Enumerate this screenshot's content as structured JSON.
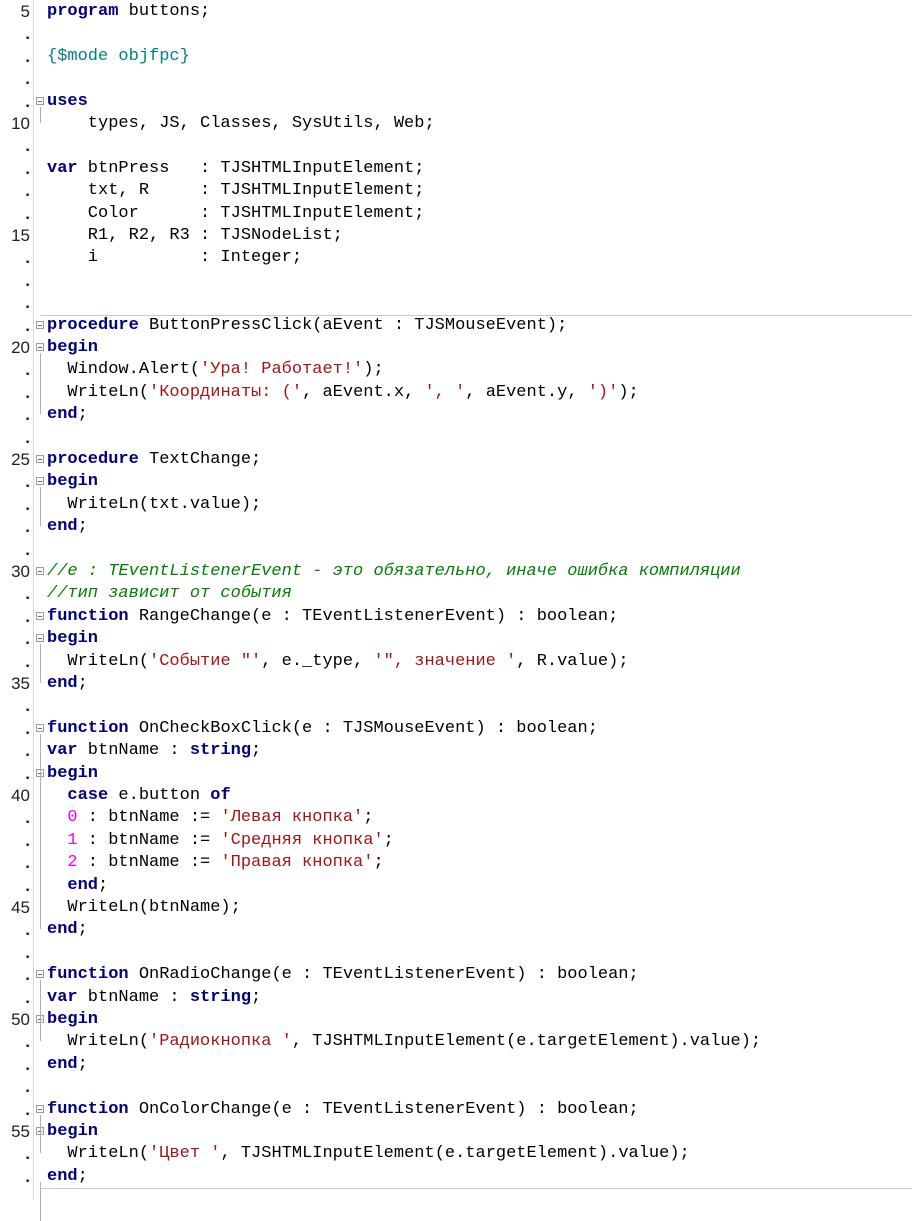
{
  "editor": {
    "lines": [
      {
        "n": "5",
        "fold": false,
        "tokens": [
          {
            "t": "kw",
            "v": "program"
          },
          {
            "t": "id",
            "v": " buttons;"
          }
        ]
      },
      {
        "n": ".",
        "fold": false,
        "tokens": []
      },
      {
        "n": ".",
        "fold": false,
        "tokens": [
          {
            "t": "dir",
            "v": "{$mode objfpc}"
          }
        ]
      },
      {
        "n": ".",
        "fold": false,
        "tokens": []
      },
      {
        "n": ".",
        "fold": true,
        "tokens": [
          {
            "t": "kw",
            "v": "uses"
          }
        ]
      },
      {
        "n": "10",
        "fold": false,
        "tokens": [
          {
            "t": "id",
            "v": "    types, JS, Classes, SysUtils, Web;"
          }
        ]
      },
      {
        "n": ".",
        "fold": false,
        "tokens": []
      },
      {
        "n": ".",
        "fold": false,
        "tokens": [
          {
            "t": "kw",
            "v": "var"
          },
          {
            "t": "id",
            "v": " btnPress   : TJSHTMLInputElement;"
          }
        ]
      },
      {
        "n": ".",
        "fold": false,
        "tokens": [
          {
            "t": "id",
            "v": "    txt, R     : TJSHTMLInputElement;"
          }
        ]
      },
      {
        "n": ".",
        "fold": false,
        "tokens": [
          {
            "t": "id",
            "v": "    Color      : TJSHTMLInputElement;"
          }
        ]
      },
      {
        "n": "15",
        "fold": false,
        "tokens": [
          {
            "t": "id",
            "v": "    R1, R2, R3 : TJSNodeList;"
          }
        ]
      },
      {
        "n": ".",
        "fold": false,
        "tokens": [
          {
            "t": "id",
            "v": "    i          : Integer;"
          }
        ]
      },
      {
        "n": ".",
        "fold": false,
        "tokens": []
      },
      {
        "n": ".",
        "fold": false,
        "tokens": []
      },
      {
        "n": ".",
        "fold": true,
        "tokens": [
          {
            "t": "kw",
            "v": "procedure"
          },
          {
            "t": "id",
            "v": " ButtonPressClick(aEvent : TJSMouseEvent);"
          }
        ]
      },
      {
        "n": "20",
        "fold": true,
        "tokens": [
          {
            "t": "kw",
            "v": "begin"
          }
        ]
      },
      {
        "n": ".",
        "fold": false,
        "tokens": [
          {
            "t": "id",
            "v": "  Window.Alert("
          },
          {
            "t": "str",
            "v": "'Ура! Работает!'"
          },
          {
            "t": "id",
            "v": ");"
          }
        ]
      },
      {
        "n": ".",
        "fold": false,
        "tokens": [
          {
            "t": "id",
            "v": "  WriteLn("
          },
          {
            "t": "str",
            "v": "'Координаты: ('"
          },
          {
            "t": "id",
            "v": ", aEvent.x, "
          },
          {
            "t": "str",
            "v": "', '"
          },
          {
            "t": "id",
            "v": ", aEvent.y, "
          },
          {
            "t": "str",
            "v": "')'"
          },
          {
            "t": "id",
            "v": ");"
          }
        ]
      },
      {
        "n": ".",
        "fold": false,
        "tokens": [
          {
            "t": "kw",
            "v": "end"
          },
          {
            "t": "id",
            "v": ";"
          }
        ]
      },
      {
        "n": ".",
        "fold": false,
        "tokens": []
      },
      {
        "n": "25",
        "fold": true,
        "tokens": [
          {
            "t": "kw",
            "v": "procedure"
          },
          {
            "t": "id",
            "v": " TextChange;"
          }
        ]
      },
      {
        "n": ".",
        "fold": true,
        "tokens": [
          {
            "t": "kw",
            "v": "begin"
          }
        ]
      },
      {
        "n": ".",
        "fold": false,
        "tokens": [
          {
            "t": "id",
            "v": "  WriteLn(txt.value);"
          }
        ]
      },
      {
        "n": ".",
        "fold": false,
        "tokens": [
          {
            "t": "kw",
            "v": "end"
          },
          {
            "t": "id",
            "v": ";"
          }
        ]
      },
      {
        "n": ".",
        "fold": false,
        "tokens": []
      },
      {
        "n": "30",
        "fold": true,
        "tokens": [
          {
            "t": "cmt",
            "v": "//e : TEventListenerEvent - это обязательно, иначе ошибка компиляции"
          }
        ]
      },
      {
        "n": ".",
        "fold": false,
        "tokens": [
          {
            "t": "cmt",
            "v": "//тип зависит от события"
          }
        ]
      },
      {
        "n": ".",
        "fold": true,
        "tokens": [
          {
            "t": "kw",
            "v": "function"
          },
          {
            "t": "id",
            "v": " RangeChange(e : TEventListenerEvent) : boolean;"
          }
        ]
      },
      {
        "n": ".",
        "fold": true,
        "tokens": [
          {
            "t": "kw",
            "v": "begin"
          }
        ]
      },
      {
        "n": ".",
        "fold": false,
        "tokens": [
          {
            "t": "id",
            "v": "  WriteLn("
          },
          {
            "t": "str",
            "v": "'Событие \"'"
          },
          {
            "t": "id",
            "v": ", e._type, "
          },
          {
            "t": "str",
            "v": "'\", значение '"
          },
          {
            "t": "id",
            "v": ", R.value);"
          }
        ]
      },
      {
        "n": "35",
        "fold": false,
        "tokens": [
          {
            "t": "kw",
            "v": "end"
          },
          {
            "t": "id",
            "v": ";"
          }
        ]
      },
      {
        "n": ".",
        "fold": false,
        "tokens": []
      },
      {
        "n": ".",
        "fold": true,
        "tokens": [
          {
            "t": "kw",
            "v": "function"
          },
          {
            "t": "id",
            "v": " OnCheckBoxClick(e : TJSMouseEvent) : boolean;"
          }
        ]
      },
      {
        "n": ".",
        "fold": false,
        "tokens": [
          {
            "t": "kw",
            "v": "var"
          },
          {
            "t": "id",
            "v": " btnName : "
          },
          {
            "t": "kw",
            "v": "string"
          },
          {
            "t": "id",
            "v": ";"
          }
        ]
      },
      {
        "n": ".",
        "fold": true,
        "tokens": [
          {
            "t": "kw",
            "v": "begin"
          }
        ]
      },
      {
        "n": "40",
        "fold": false,
        "tokens": [
          {
            "t": "id",
            "v": "  "
          },
          {
            "t": "kw",
            "v": "case"
          },
          {
            "t": "id",
            "v": " e.button "
          },
          {
            "t": "kw",
            "v": "of"
          }
        ]
      },
      {
        "n": ".",
        "fold": false,
        "tokens": [
          {
            "t": "id",
            "v": "  "
          },
          {
            "t": "num",
            "v": "0"
          },
          {
            "t": "id",
            "v": " : btnName := "
          },
          {
            "t": "str",
            "v": "'Левая кнопка'"
          },
          {
            "t": "id",
            "v": ";"
          }
        ]
      },
      {
        "n": ".",
        "fold": false,
        "tokens": [
          {
            "t": "id",
            "v": "  "
          },
          {
            "t": "num",
            "v": "1"
          },
          {
            "t": "id",
            "v": " : btnName := "
          },
          {
            "t": "str",
            "v": "'Средняя кнопка'"
          },
          {
            "t": "id",
            "v": ";"
          }
        ]
      },
      {
        "n": ".",
        "fold": false,
        "tokens": [
          {
            "t": "id",
            "v": "  "
          },
          {
            "t": "num",
            "v": "2"
          },
          {
            "t": "id",
            "v": " : btnName := "
          },
          {
            "t": "str",
            "v": "'Правая кнопка'"
          },
          {
            "t": "id",
            "v": ";"
          }
        ]
      },
      {
        "n": ".",
        "fold": false,
        "tokens": [
          {
            "t": "id",
            "v": "  "
          },
          {
            "t": "kw",
            "v": "end"
          },
          {
            "t": "id",
            "v": ";"
          }
        ]
      },
      {
        "n": "45",
        "fold": false,
        "tokens": [
          {
            "t": "id",
            "v": "  WriteLn(btnName);"
          }
        ]
      },
      {
        "n": ".",
        "fold": false,
        "tokens": [
          {
            "t": "kw",
            "v": "end"
          },
          {
            "t": "id",
            "v": ";"
          }
        ]
      },
      {
        "n": ".",
        "fold": false,
        "tokens": []
      },
      {
        "n": ".",
        "fold": true,
        "tokens": [
          {
            "t": "kw",
            "v": "function"
          },
          {
            "t": "id",
            "v": " OnRadioChange(e : TEventListenerEvent) : boolean;"
          }
        ]
      },
      {
        "n": ".",
        "fold": false,
        "tokens": [
          {
            "t": "kw",
            "v": "var"
          },
          {
            "t": "id",
            "v": " btnName : "
          },
          {
            "t": "kw",
            "v": "string"
          },
          {
            "t": "id",
            "v": ";"
          }
        ]
      },
      {
        "n": "50",
        "fold": true,
        "tokens": [
          {
            "t": "kw",
            "v": "begin"
          }
        ]
      },
      {
        "n": ".",
        "fold": false,
        "tokens": [
          {
            "t": "id",
            "v": "  WriteLn("
          },
          {
            "t": "str",
            "v": "'Радиокнопка '"
          },
          {
            "t": "id",
            "v": ", TJSHTMLInputElement(e.targetElement).value);"
          }
        ]
      },
      {
        "n": ".",
        "fold": false,
        "tokens": [
          {
            "t": "kw",
            "v": "end"
          },
          {
            "t": "id",
            "v": ";"
          }
        ]
      },
      {
        "n": ".",
        "fold": false,
        "tokens": []
      },
      {
        "n": ".",
        "fold": true,
        "tokens": [
          {
            "t": "kw",
            "v": "function"
          },
          {
            "t": "id",
            "v": " OnColorChange(e : TEventListenerEvent) : boolean;"
          }
        ]
      },
      {
        "n": "55",
        "fold": true,
        "tokens": [
          {
            "t": "kw",
            "v": "begin"
          }
        ]
      },
      {
        "n": ".",
        "fold": false,
        "tokens": [
          {
            "t": "id",
            "v": "  WriteLn("
          },
          {
            "t": "str",
            "v": "'Цвет '"
          },
          {
            "t": "id",
            "v": ", TJSHTMLInputElement(e.targetElement).value);"
          }
        ]
      },
      {
        "n": ".",
        "fold": false,
        "tokens": [
          {
            "t": "kw",
            "v": "end"
          },
          {
            "t": "id",
            "v": ";"
          }
        ]
      }
    ]
  },
  "colors": {
    "keyword": "#000080",
    "string": "#a31515",
    "number": "#ff00ff",
    "comment": "#008000",
    "directive": "#008080"
  }
}
